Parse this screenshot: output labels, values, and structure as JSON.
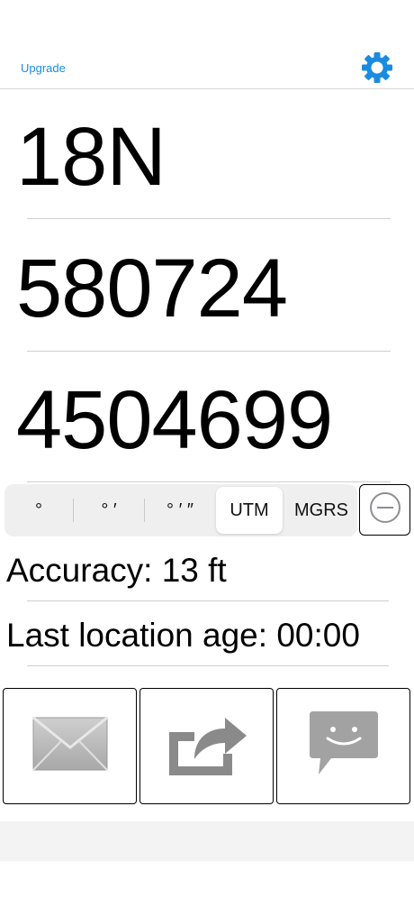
{
  "header": {
    "upgrade_label": "Upgrade",
    "settings_icon": "gear-icon",
    "accent_color": "#1a8ce0"
  },
  "coordinates": {
    "zone": "18N",
    "easting": "580724",
    "northing": "4504699"
  },
  "format_selector": {
    "options": [
      "°",
      "° ′",
      "° ′ ″",
      "UTM",
      "MGRS"
    ],
    "selected": "UTM",
    "remove_icon": "minus-circle-icon"
  },
  "info": {
    "accuracy": "Accuracy: 13 ft",
    "last_location_age": "Last location age: 00:00"
  },
  "actions": {
    "email_icon": "envelope-icon",
    "share_icon": "share-arrow-icon",
    "message_icon": "message-bubble-icon"
  }
}
